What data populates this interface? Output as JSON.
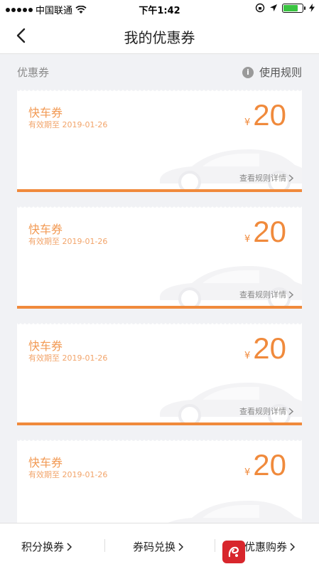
{
  "status_bar": {
    "carrier": "中国联通",
    "time": "下午1:42"
  },
  "nav": {
    "title": "我的优惠券"
  },
  "section": {
    "label": "优惠券",
    "rules_label": "使用规则",
    "rules_icon": "info-icon"
  },
  "coupons": [
    {
      "name": "快车券",
      "expiry": "有效期至 2019-01-26",
      "currency": "¥",
      "amount": "20",
      "detail_label": "查看规则详情"
    },
    {
      "name": "快车券",
      "expiry": "有效期至 2019-01-26",
      "currency": "¥",
      "amount": "20",
      "detail_label": "查看规则详情"
    },
    {
      "name": "快车券",
      "expiry": "有效期至 2019-01-26",
      "currency": "¥",
      "amount": "20",
      "detail_label": "查看规则详情"
    },
    {
      "name": "快车券",
      "expiry": "有效期至 2019-01-26",
      "currency": "¥",
      "amount": "20"
    }
  ],
  "bottom_bar": {
    "points_exchange": "积分换券",
    "code_redeem": "券码兑换",
    "buy_coupons": "优惠购券"
  },
  "colors": {
    "accent": "#f08a3c",
    "coupon_text": "#f29a54",
    "background": "#f1f2f5"
  }
}
